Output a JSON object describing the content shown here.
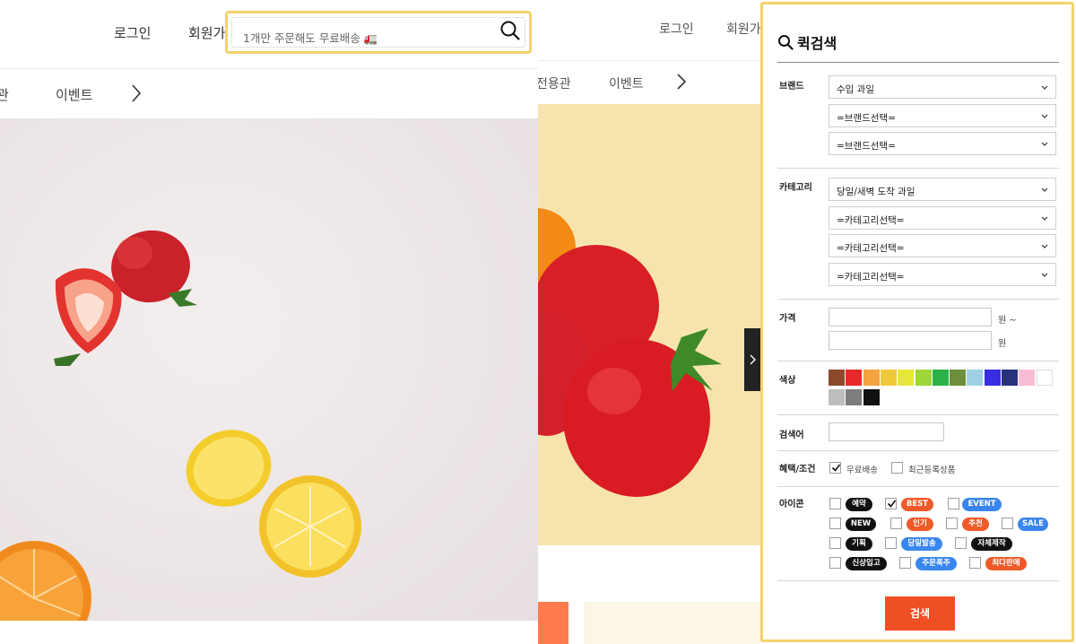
{
  "left_header": {
    "login": "로그인",
    "signup": "회원가",
    "search_placeholder": "1개만 주문해도 무료배송 🚛"
  },
  "left_nav": {
    "partial": "관",
    "event": "이벤트"
  },
  "mid_header": {
    "login": "로그인",
    "signup": "회원가"
  },
  "mid_nav": {
    "partial": "전용관",
    "event": "이벤트"
  },
  "quick_search": {
    "title": "퀵검색",
    "brand": {
      "label": "브랜드",
      "selects": [
        "수입 과일",
        "=브랜드선택=",
        "=브랜드선택="
      ]
    },
    "category": {
      "label": "카테고리",
      "selects": [
        "당일/새벽 도착 과일",
        "=카테고리선택=",
        "=카테고리선택=",
        "=카테고리선택="
      ]
    },
    "price": {
      "label": "가격",
      "unit_from": "원 ~",
      "unit_to": "원"
    },
    "color": {
      "label": "색상",
      "swatches": [
        "#8b4a2b",
        "#e8282b",
        "#f4a340",
        "#f0c93b",
        "#e5e839",
        "#9ed63a",
        "#2bb34a",
        "#6d8e3a",
        "#9fd0e6",
        "#3a2ee2",
        "#27327a",
        "#f7bdd4",
        "#ffffff",
        "#bdbdbd",
        "#7d7d7d",
        "#111111"
      ]
    },
    "keyword": {
      "label": "검색어"
    },
    "benefit": {
      "label": "혜택/조건",
      "options": [
        "무료배송",
        "최근등록상품"
      ]
    },
    "icon": {
      "label": "아이콘",
      "badges": [
        "예약",
        "BEST",
        "EVENT",
        "NEW",
        "인기",
        "추천",
        "SALE",
        "기획",
        "당일발송",
        "자체제작",
        "신상입고",
        "주문폭주",
        "최다판매"
      ]
    },
    "submit": "검색"
  }
}
